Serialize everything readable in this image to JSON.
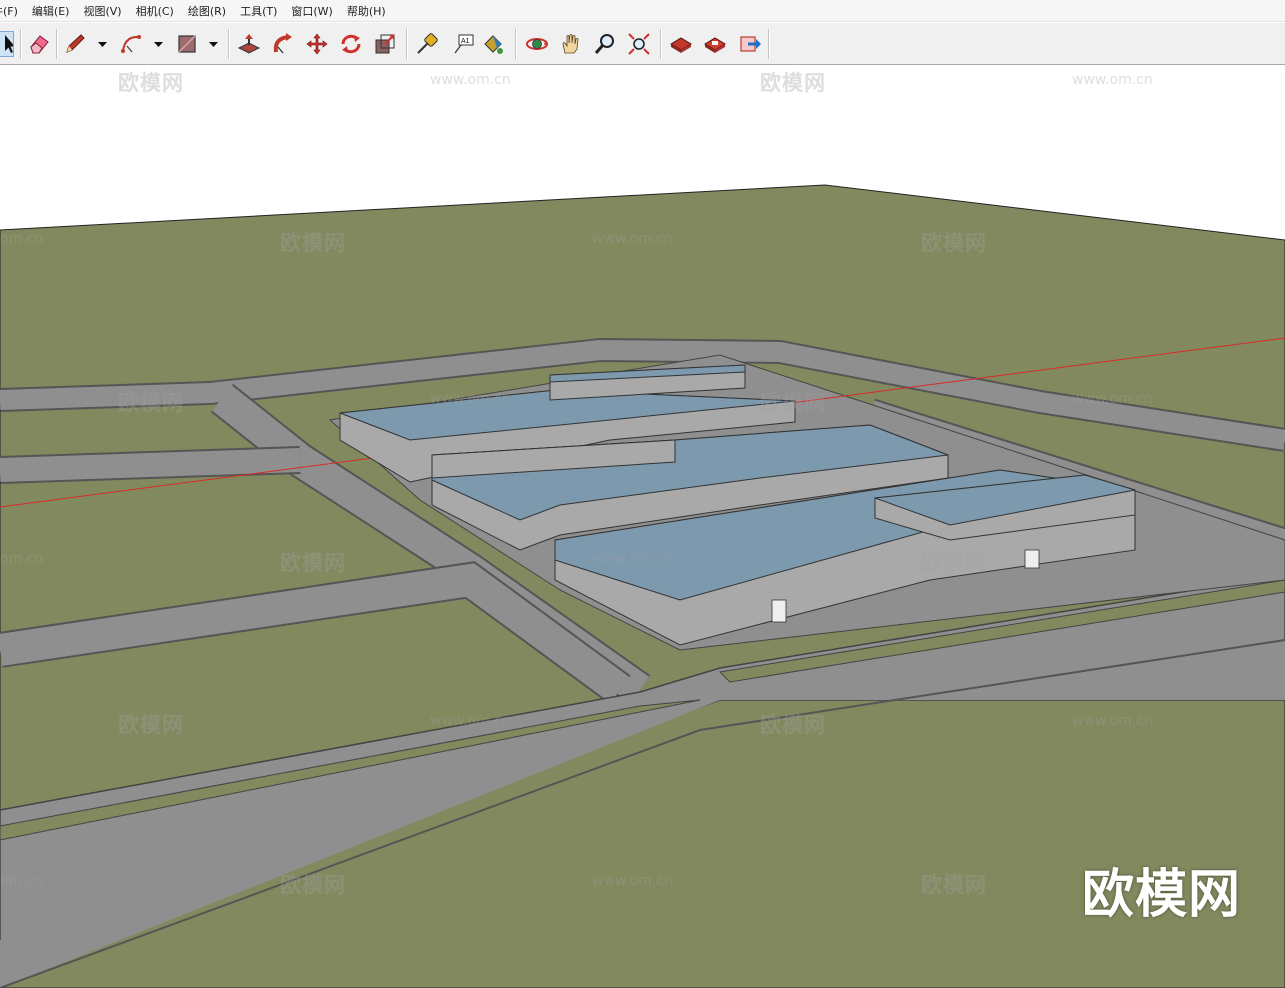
{
  "menu": [
    {
      "name": "menu-file",
      "label": "件(F)"
    },
    {
      "name": "menu-edit",
      "label": "编辑(E)"
    },
    {
      "name": "menu-view",
      "label": "视图(V)"
    },
    {
      "name": "menu-camera",
      "label": "相机(C)"
    },
    {
      "name": "menu-draw",
      "label": "绘图(R)"
    },
    {
      "name": "menu-tools",
      "label": "工具(T)"
    },
    {
      "name": "menu-window",
      "label": "窗口(W)"
    },
    {
      "name": "menu-help",
      "label": "帮助(H)"
    }
  ],
  "toolbar": {
    "tools": [
      {
        "name": "select-tool",
        "icon": "arrow-cursor-icon"
      },
      {
        "name": "eraser-tool",
        "icon": "eraser-icon"
      },
      {
        "name": "pencil-tool",
        "icon": "pencil-icon"
      },
      {
        "name": "arc-tool",
        "icon": "arc-icon"
      },
      {
        "name": "rectangle-tool",
        "icon": "rectangle-icon"
      },
      {
        "name": "push-pull-tool",
        "icon": "push-pull-icon"
      },
      {
        "name": "follow-me-tool",
        "icon": "follow-me-icon"
      },
      {
        "name": "move-tool",
        "icon": "move-arrows-icon"
      },
      {
        "name": "rotate-tool",
        "icon": "rotate-icon"
      },
      {
        "name": "scale-tool",
        "icon": "scale-icon"
      },
      {
        "name": "tape-measure-tool",
        "icon": "tape-measure-icon"
      },
      {
        "name": "text-tool",
        "icon": "text-label-icon"
      },
      {
        "name": "paint-bucket-tool",
        "icon": "paint-bucket-icon"
      },
      {
        "name": "orbit-tool",
        "icon": "orbit-icon"
      },
      {
        "name": "pan-tool",
        "icon": "hand-icon"
      },
      {
        "name": "zoom-tool",
        "icon": "magnifier-icon"
      },
      {
        "name": "zoom-extents-tool",
        "icon": "zoom-extents-icon"
      },
      {
        "name": "3d-warehouse-tool",
        "icon": "warehouse-icon"
      },
      {
        "name": "extension-warehouse-tool",
        "icon": "extension-warehouse-icon"
      },
      {
        "name": "share-model-tool",
        "icon": "share-model-icon"
      }
    ],
    "text_tool_glyph": "A1"
  },
  "watermarks": {
    "brand": "欧模网",
    "url": "www.om.cn",
    "partial_url": "om.cn"
  },
  "colors": {
    "ground": "#83895e",
    "road": "#8f8f8f",
    "roof": "#7d99ad",
    "wall": "#a9a9a9",
    "axis_red": "#d62a2a"
  }
}
